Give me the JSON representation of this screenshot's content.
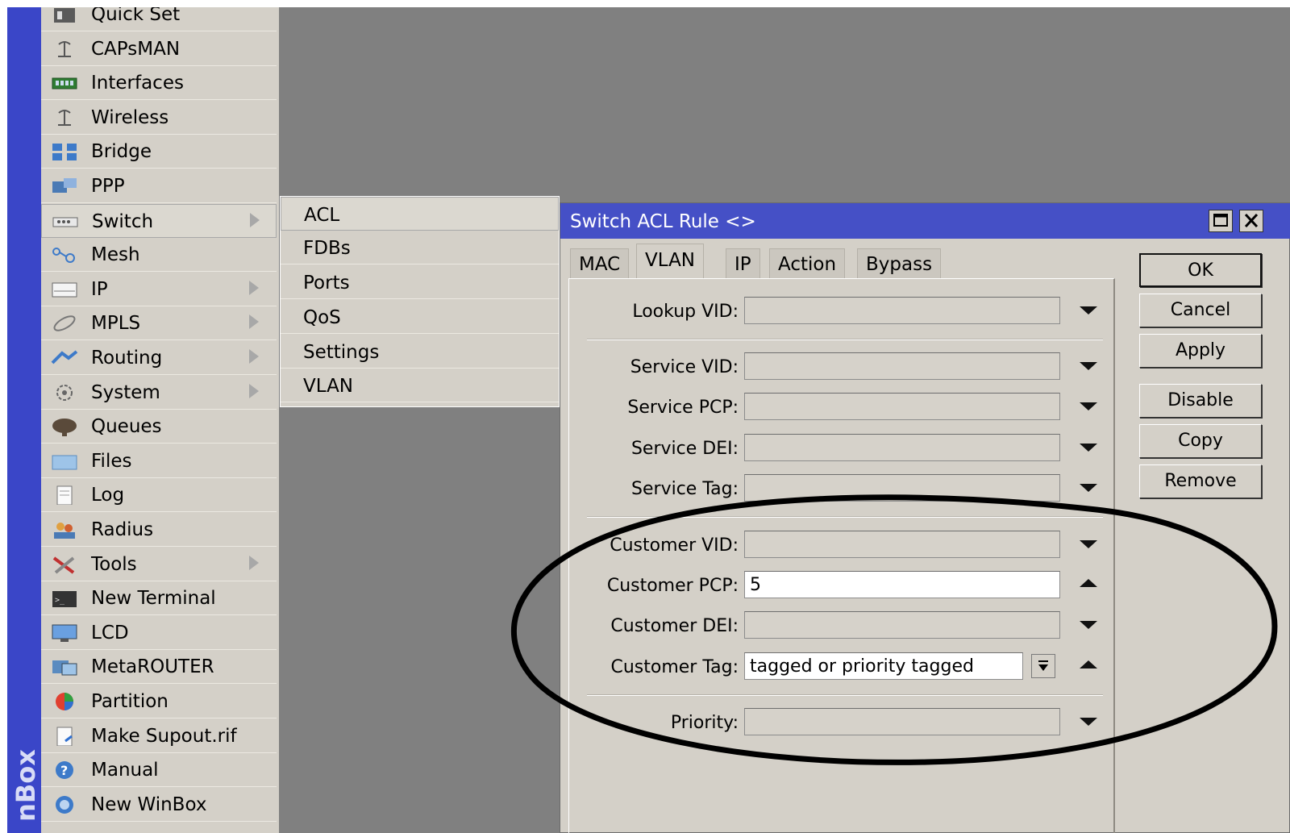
{
  "brand": {
    "text": "nBox"
  },
  "menu": {
    "items": [
      {
        "label": "Quick Set",
        "icon": "quick-set-icon",
        "submenu": false
      },
      {
        "label": "CAPsMAN",
        "icon": "capsman-icon",
        "submenu": false
      },
      {
        "label": "Interfaces",
        "icon": "interfaces-icon",
        "submenu": false
      },
      {
        "label": "Wireless",
        "icon": "wireless-icon",
        "submenu": false
      },
      {
        "label": "Bridge",
        "icon": "bridge-icon",
        "submenu": false
      },
      {
        "label": "PPP",
        "icon": "ppp-icon",
        "submenu": false
      },
      {
        "label": "Switch",
        "icon": "switch-icon",
        "submenu": true,
        "selected": true
      },
      {
        "label": "Mesh",
        "icon": "mesh-icon",
        "submenu": false
      },
      {
        "label": "IP",
        "icon": "ip-icon",
        "submenu": true
      },
      {
        "label": "MPLS",
        "icon": "mpls-icon",
        "submenu": true
      },
      {
        "label": "Routing",
        "icon": "routing-icon",
        "submenu": true
      },
      {
        "label": "System",
        "icon": "system-icon",
        "submenu": true
      },
      {
        "label": "Queues",
        "icon": "queues-icon",
        "submenu": false
      },
      {
        "label": "Files",
        "icon": "files-icon",
        "submenu": false
      },
      {
        "label": "Log",
        "icon": "log-icon",
        "submenu": false
      },
      {
        "label": "Radius",
        "icon": "radius-icon",
        "submenu": false
      },
      {
        "label": "Tools",
        "icon": "tools-icon",
        "submenu": true
      },
      {
        "label": "New Terminal",
        "icon": "terminal-icon",
        "submenu": false
      },
      {
        "label": "LCD",
        "icon": "lcd-icon",
        "submenu": false
      },
      {
        "label": "MetaROUTER",
        "icon": "metarouter-icon",
        "submenu": false
      },
      {
        "label": "Partition",
        "icon": "partition-icon",
        "submenu": false
      },
      {
        "label": "Make Supout.rif",
        "icon": "supout-icon",
        "submenu": false
      },
      {
        "label": "Manual",
        "icon": "manual-icon",
        "submenu": false
      },
      {
        "label": "New WinBox",
        "icon": "winbox-icon",
        "submenu": false
      }
    ]
  },
  "submenu": {
    "items": [
      "ACL",
      "FDBs",
      "Ports",
      "QoS",
      "Settings",
      "VLAN"
    ],
    "selected": "ACL"
  },
  "dialog": {
    "title": "Switch ACL Rule <>",
    "tabs": [
      "MAC",
      "VLAN",
      "IP",
      "Action",
      "Bypass"
    ],
    "active_tab": "VLAN",
    "fields": {
      "lookup_vid": {
        "label": "Lookup VID:",
        "value": ""
      },
      "service_vid": {
        "label": "Service VID:",
        "value": ""
      },
      "service_pcp": {
        "label": "Service PCP:",
        "value": ""
      },
      "service_dei": {
        "label": "Service DEI:",
        "value": ""
      },
      "service_tag": {
        "label": "Service Tag:",
        "value": ""
      },
      "customer_vid": {
        "label": "Customer VID:",
        "value": ""
      },
      "customer_pcp": {
        "label": "Customer PCP:",
        "value": "5"
      },
      "customer_dei": {
        "label": "Customer DEI:",
        "value": ""
      },
      "customer_tag": {
        "label": "Customer Tag:",
        "value": "tagged or priority tagged"
      },
      "priority": {
        "label": "Priority:",
        "value": ""
      }
    },
    "buttons": {
      "ok": "OK",
      "cancel": "Cancel",
      "apply": "Apply",
      "disable": "Disable",
      "copy": "Copy",
      "remove": "Remove"
    }
  },
  "colors": {
    "titlebar": "#4550c6",
    "brandbar": "#3a46c8",
    "panel": "#d4d0c8",
    "background": "#808080",
    "annotation": "#000000"
  }
}
